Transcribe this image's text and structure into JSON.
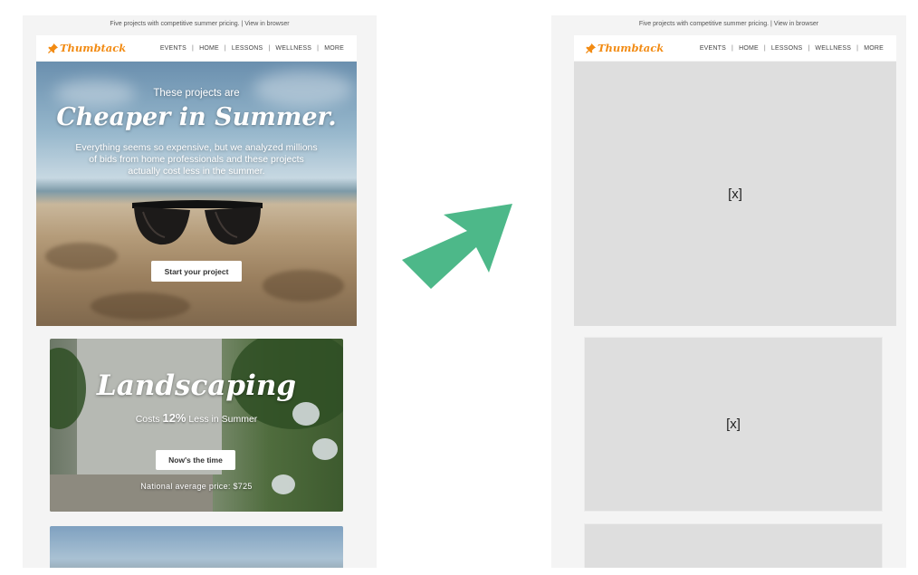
{
  "preheader": "Five projects with competitive summer pricing. | View in browser",
  "brand": {
    "name": "Thumbtack",
    "color": "#f28b13",
    "icon": "thumbtack-pin-icon"
  },
  "nav": [
    "EVENTS",
    "HOME",
    "LESSONS",
    "WELLNESS",
    "MORE"
  ],
  "hero": {
    "subtitle": "These projects are",
    "title": "Cheaper in Summer.",
    "body": "Everything seems so expensive, but we analyzed millions of bids from home professionals and these projects actually cost less in the summer.",
    "cta": "Start your project"
  },
  "landscaping": {
    "title": "Landscaping",
    "costs_prefix": "Costs",
    "percent": "12%",
    "costs_suffix": "Less in Summer",
    "cta": "Now's the time",
    "price": "National average price: $725"
  },
  "arrow": {
    "color": "#4db889",
    "icon": "arrow-up-right-icon"
  },
  "placeholder": {
    "label": "[x]"
  }
}
